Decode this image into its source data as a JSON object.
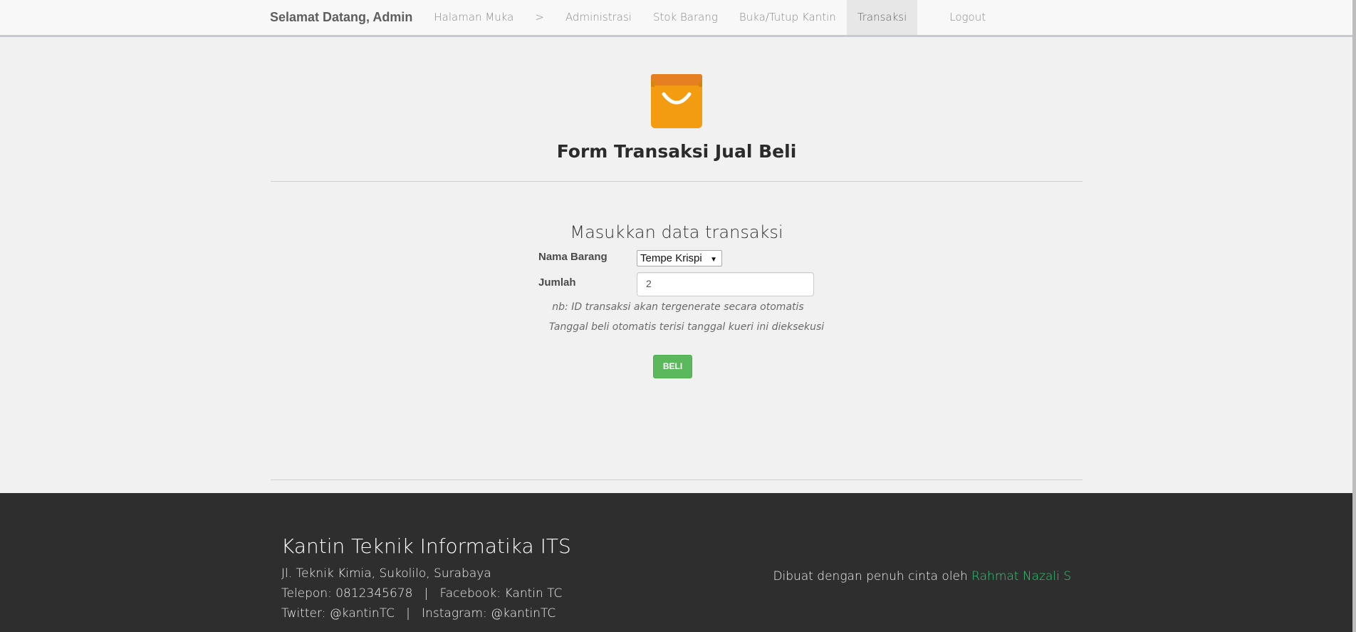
{
  "navbar": {
    "brand": "Selamat Datang, Admin",
    "items": [
      {
        "label": "Halaman Muka"
      },
      {
        "label": ">"
      },
      {
        "label": "Administrasi"
      },
      {
        "label": "Stok Barang"
      },
      {
        "label": "Buka/Tutup Kantin"
      },
      {
        "label": "Transaksi"
      },
      {
        "label": "Logout"
      }
    ],
    "active_item": "Transaksi"
  },
  "header": {
    "icon": "shopping-bag-icon",
    "title": "Form Transaksi Jual Beli"
  },
  "form": {
    "title": "Masukkan data transaksi",
    "nama_barang_label": "Nama Barang",
    "nama_barang_value": "Tempe Krispi",
    "jumlah_label": "Jumlah",
    "jumlah_value": "2",
    "note1": "nb: ID transaksi akan tergenerate secara otomatis",
    "note2": "Tanggal beli otomatis terisi tanggal kueri ini dieksekusi",
    "submit_label": "BELI"
  },
  "footer": {
    "title": "Kantin Teknik Informatika ITS",
    "address": "Jl. Teknik Kimia, Sukolilo, Surabaya",
    "line2": "Telepon: 0812345678   |   Facebook: Kantin TC",
    "line3": "Twitter: @kantinTC   |   Instagram: @kantinTC",
    "credit_prefix": "Dibuat dengan penuh cinta oleh ",
    "credit_name": "Rahmat Nazali S"
  },
  "colors": {
    "accent_green": "#5cb85c",
    "link_green": "#2ecc71",
    "bag_orange": "#f39c12",
    "footer_bg": "#2e2e2e"
  }
}
